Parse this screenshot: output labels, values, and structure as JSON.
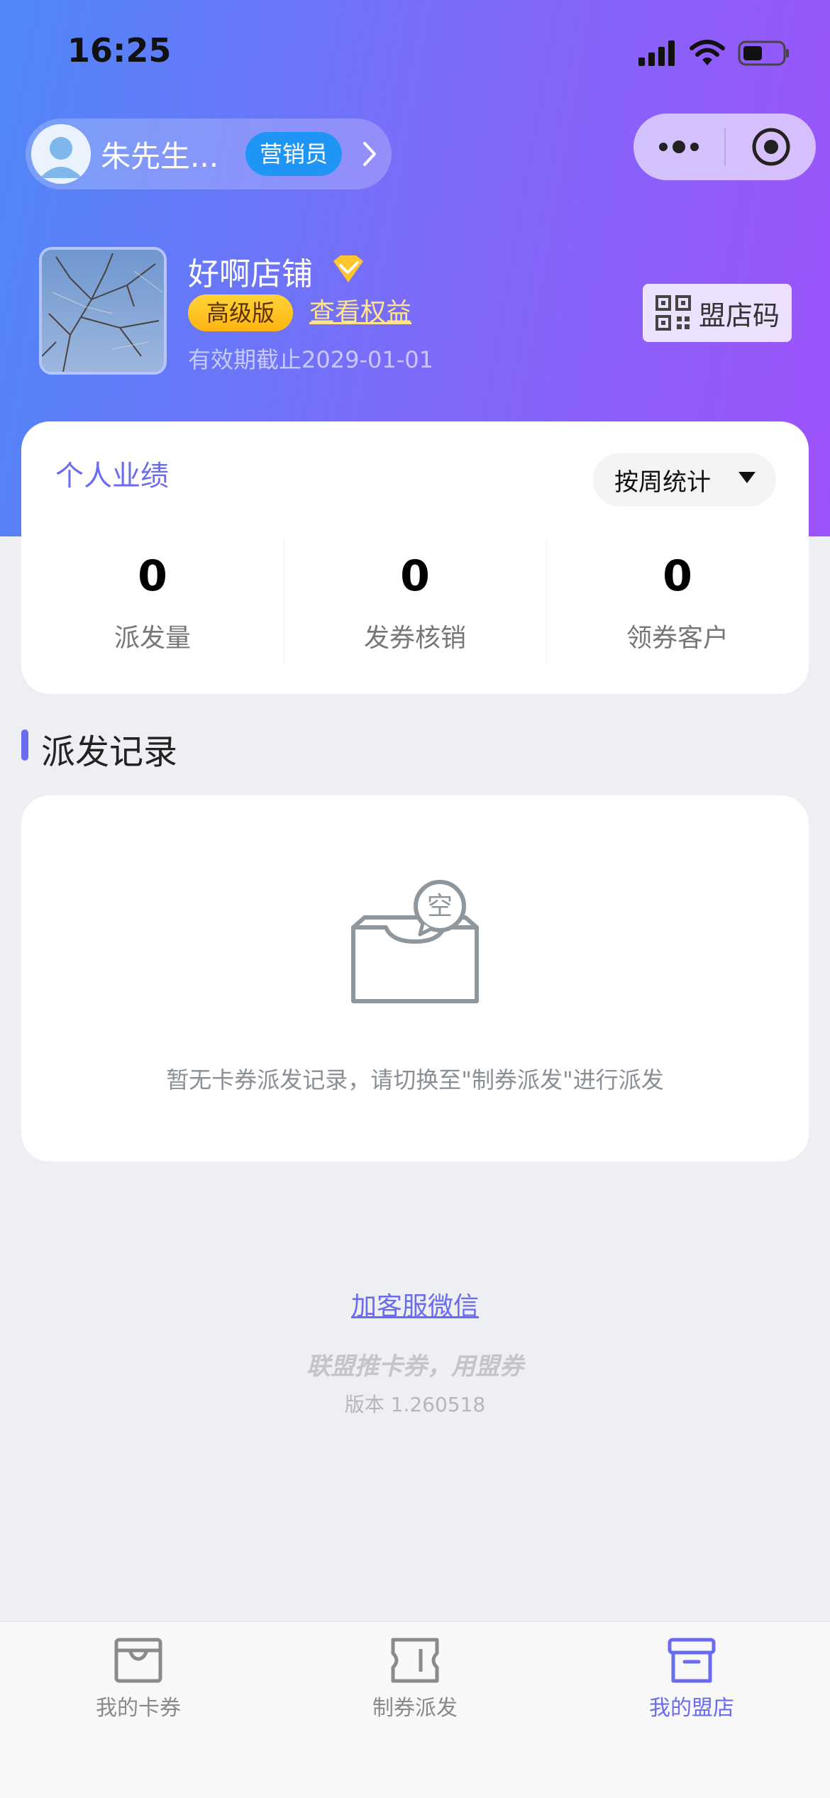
{
  "status_bar": {
    "time": "16:25"
  },
  "user": {
    "name": "朱先生...",
    "role": "营销员"
  },
  "shop": {
    "name": "好啊店铺",
    "level": "高级版",
    "benefits_link": "查看权益",
    "expiry": "有效期截止2029-01-01",
    "qr_label": "盟店码"
  },
  "stats": {
    "title": "个人业绩",
    "period": "按周统计",
    "items": [
      {
        "value": "0",
        "label": "派发量"
      },
      {
        "value": "0",
        "label": "发券核销"
      },
      {
        "value": "0",
        "label": "领券客户"
      }
    ]
  },
  "records": {
    "title": "派发记录",
    "empty_badge": "空",
    "empty_text": "暂无卡券派发记录，请切换至\"制券派发\"进行派发"
  },
  "footer": {
    "support_link": "加客服微信",
    "slogan": "联盟推卡券，用盟券",
    "version": "版本 1.260518"
  },
  "tabs": [
    {
      "label": "我的卡券",
      "icon": "card-wallet-icon",
      "active": false
    },
    {
      "label": "制券派发",
      "icon": "ticket-icon",
      "active": false
    },
    {
      "label": "我的盟店",
      "icon": "store-box-icon",
      "active": true
    }
  ],
  "colors": {
    "accent": "#6a6cf0",
    "role_badge": "#1f96f5",
    "level_badge": "#ffc21f"
  }
}
